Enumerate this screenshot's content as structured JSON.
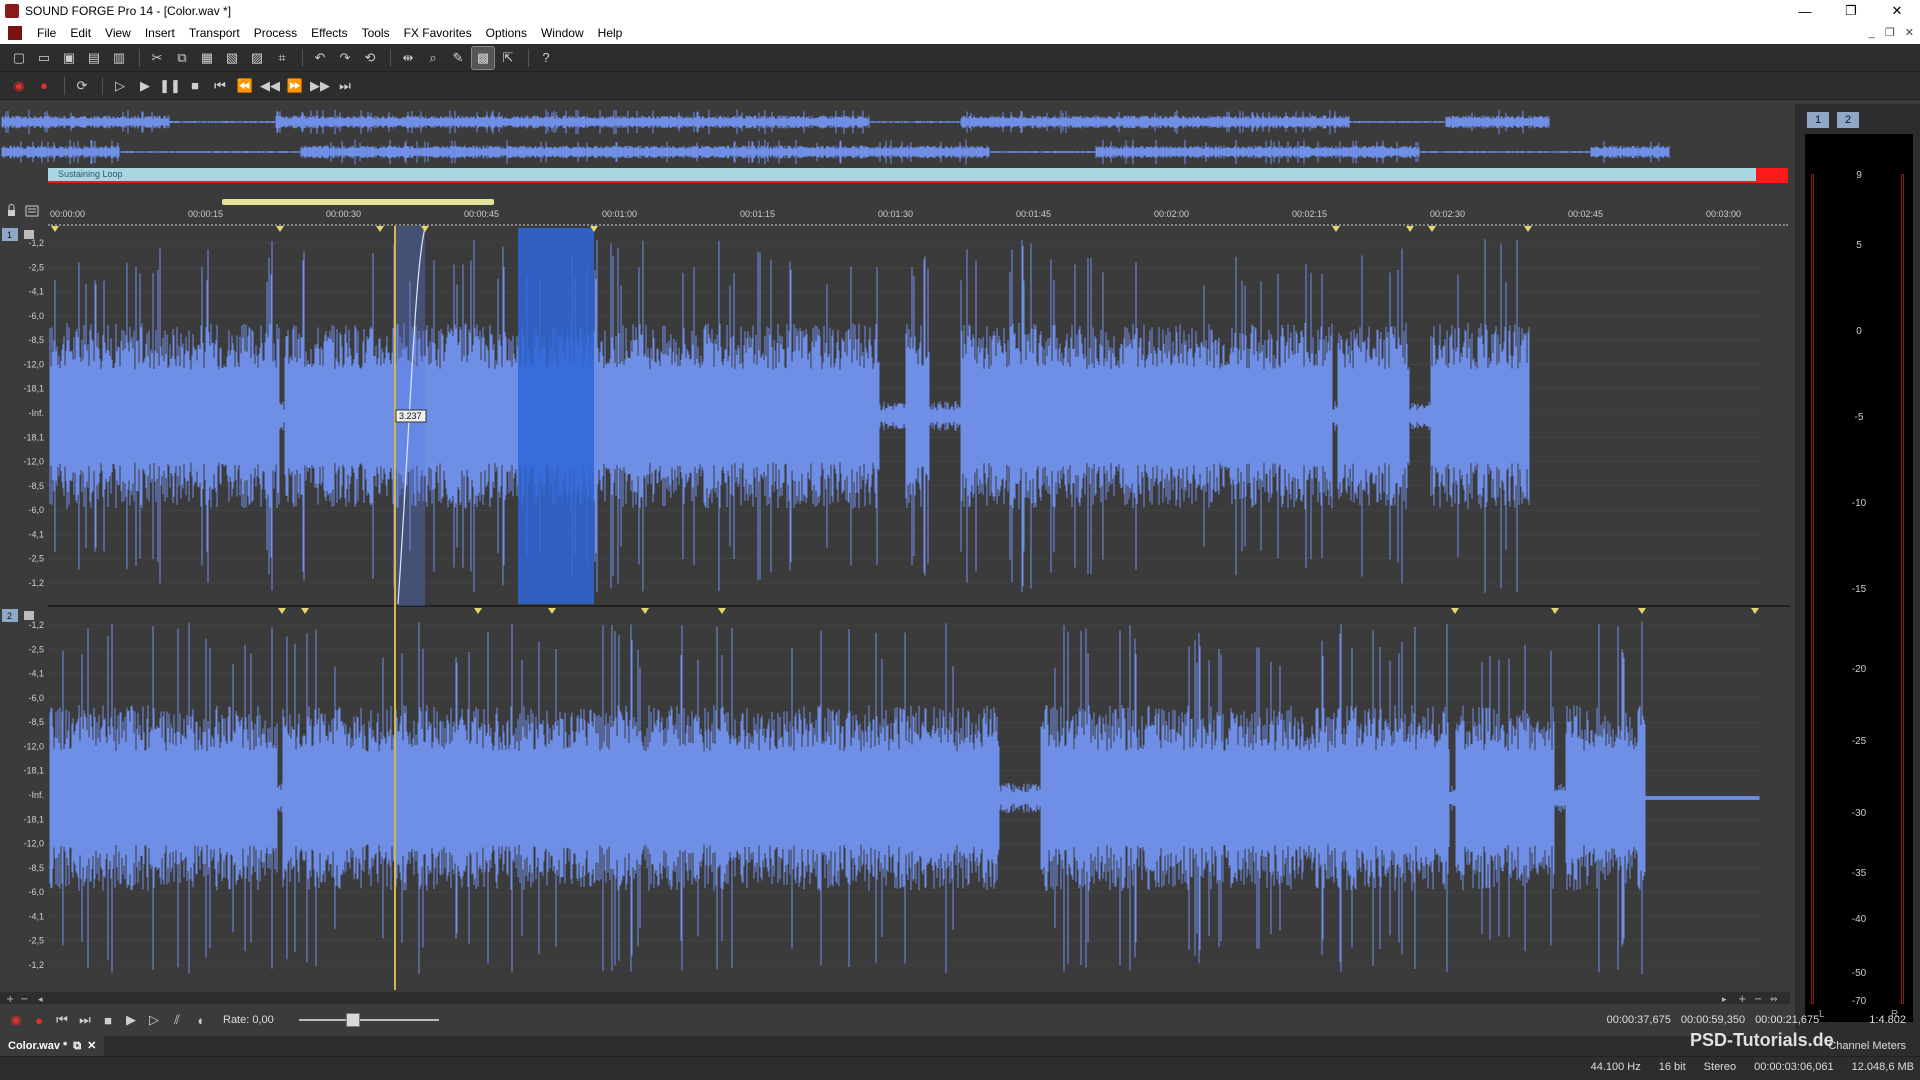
{
  "window": {
    "title": "SOUND FORGE Pro 14 - [Color.wav *]",
    "controls": [
      "—",
      "❐",
      "✕"
    ]
  },
  "menu": {
    "items": [
      "File",
      "Edit",
      "View",
      "Insert",
      "Transport",
      "Process",
      "Effects",
      "Tools",
      "FX Favorites",
      "Options",
      "Window",
      "Help"
    ],
    "mdi_controls": [
      "_",
      "❐",
      "✕"
    ]
  },
  "loop": {
    "label": "Sustaining Loop"
  },
  "ruler": {
    "ticks": [
      "00:00:00",
      "00:00:15",
      "00:00:30",
      "00:00:45",
      "00:01:00",
      "00:01:15",
      "00:01:30",
      "00:01:45",
      "00:02:00",
      "00:02:15",
      "00:02:30",
      "00:02:45",
      "00:03:00"
    ]
  },
  "channels": {
    "ch1_label": "1",
    "ch2_label": "2",
    "db_labels": [
      "-1,2",
      "-2,5",
      "-4,1",
      "-6,0",
      "-8,5",
      "-12,0",
      "-18,1",
      "-Inf.",
      "-18,1",
      "-12,0",
      "-8,5",
      "-6,0",
      "-4,1",
      "-2,5",
      "-1,2"
    ],
    "cursor_readout": "3.237"
  },
  "meter": {
    "tabs": [
      "1",
      "2"
    ],
    "scale": [
      "9",
      "5",
      "0",
      "-5",
      "-10",
      "-15",
      "-20",
      "-25",
      "-30",
      "-35",
      "-40",
      "-50",
      "-70"
    ],
    "left": "L",
    "right": "R"
  },
  "transport": {
    "rate_label": "Rate: 0,00",
    "rate_value": 0.37,
    "sel_start": "00:00:37,675",
    "sel_end": "00:00:59,350",
    "sel_length": "00:00:21,675",
    "zoom": "1:4.802"
  },
  "doc_tab": {
    "name": "Color.wav *",
    "right_label": "Channel Meters"
  },
  "status": {
    "sample_rate": "44.100 Hz",
    "bit_depth": "16 bit",
    "channels": "Stereo",
    "duration": "00:00:03:06,061",
    "size": "12.048,6 MB"
  },
  "watermark": "PSD-Tutorials.de",
  "colors": {
    "wave": "#6f8ee6",
    "selection": "#2f66d8",
    "cursor": "#d4b84a",
    "loop_bar": "#a8d7e2"
  }
}
